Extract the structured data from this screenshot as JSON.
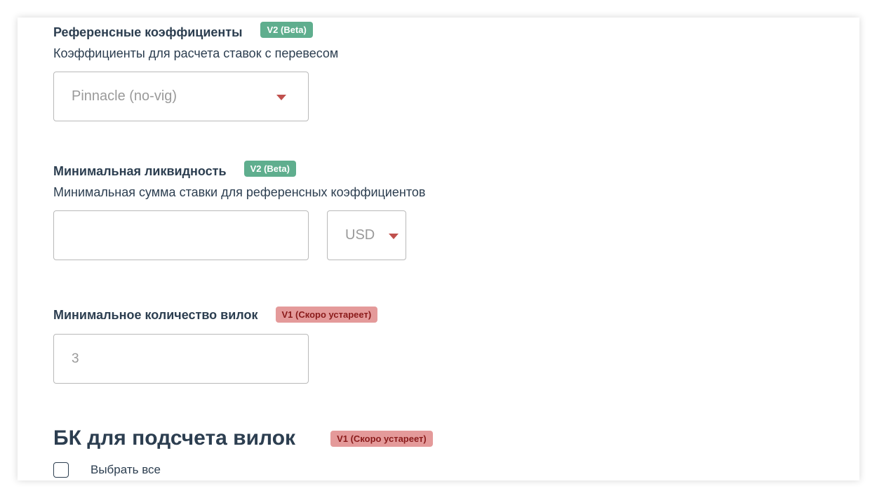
{
  "reference_odds": {
    "label": "Референсные коэффициенты",
    "badge": "V2 (Beta)",
    "description": "Коэффициенты для расчета ставок с перевесом",
    "select_value": "Pinnacle (no-vig)"
  },
  "min_liquidity": {
    "label": "Минимальная ликвидность",
    "badge": "V2 (Beta)",
    "description": "Минимальная сумма ставки для референсных коэффициентов",
    "amount_value": "",
    "currency_value": "USD"
  },
  "min_forks": {
    "label": "Минимальное количество вилок",
    "badge": "V1 (Скоро устареет)",
    "placeholder": "3"
  },
  "bookmakers": {
    "title": "БК для подсчета вилок",
    "badge": "V1 (Скоро устареет)",
    "select_all_label": "Выбрать все",
    "select_all_checked": false
  },
  "colors": {
    "beta_badge": "#5fae8e",
    "deprecated_badge": "#e49a9a",
    "caret": "#c0504d",
    "text": "#2c3e50"
  }
}
